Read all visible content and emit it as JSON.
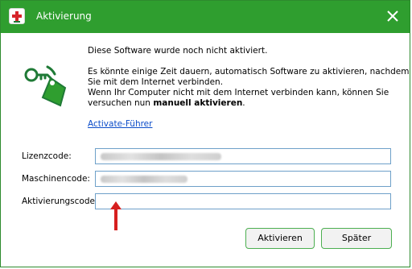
{
  "window": {
    "title": "Aktivierung",
    "app_icon": "red-cross-icon",
    "close_icon": "close-icon"
  },
  "message": {
    "line1": "Diese Software wurde noch nicht aktiviert.",
    "line2a": "Es könnte einige Zeit dauern, automatisch Software zu aktivieren, nachdem",
    "line2b": "Sie mit dem Internet verbinden.",
    "line3a": "Wenn Ihr Computer nicht mit dem Internet verbinden kann, können Sie",
    "line3b_prefix": "versuchen nun ",
    "line3b_bold": "manuell aktivieren",
    "line3b_suffix": "."
  },
  "link": {
    "label": "Activate-Führer"
  },
  "form": {
    "license_label": "Lizenzcode:",
    "license_value": "",
    "machine_label": "Maschinencode:",
    "machine_value": "",
    "activation_label": "Aktivierungscode:",
    "activation_value": ""
  },
  "buttons": {
    "activate_label": "Aktivieren",
    "later_label": "Später"
  },
  "colors": {
    "titlebar": "#2f9e2f",
    "accent_green": "#1f7a36",
    "link": "#0b4cc9",
    "field_border": "#6ea0c9",
    "arrow": "#d61f1f"
  }
}
